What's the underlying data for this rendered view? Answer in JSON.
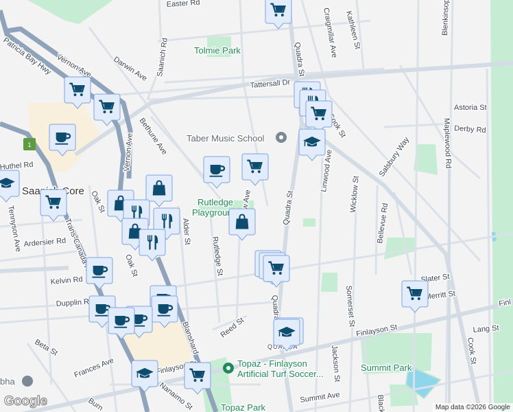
{
  "map": {
    "streets": {
      "easter": "Easter Rd",
      "saanich": "Saanich Rd",
      "darwin": "Darwin Ave",
      "vernon1": "Vernon Ave",
      "vernon2": "Vernon Ave",
      "patricia": "Patricia Bay Hwy",
      "tattersall": "Tattersall Dr",
      "bethune": "Bethune Ave",
      "quadra1": "Quadra St",
      "quadra2": "Quadra St",
      "quadra3": "Quadra St",
      "craigmillar": "Craigmillar Ave",
      "kathleen": "Kathleen St",
      "blenkinsop": "Blenkinsop",
      "astoria": "Astoria St",
      "derby": "Derby Rd",
      "maplewood": "Maplewood Rd",
      "salsbury": "Salsbury Way",
      "linwood": "Linwood Ave",
      "wicklow": "Wicklow St",
      "bellevue": "Bellevue Rd",
      "cook1": "Cook St",
      "cook2": "Cook St",
      "huthel": "Huthel Rd",
      "oak1": "Oak St",
      "oak2": "Oak St",
      "tennyson": "Tennyson Ave",
      "ardersier": "Ardersier Rd",
      "transcanada": "Trans-Canada Hwy",
      "kelvin": "Kelvin Rd",
      "dupplin": "Dupplin Rd",
      "glasgow": "Glasgow Ave",
      "alder": "Alder St",
      "rutledge": "Rutledge St",
      "reed": "Reed St",
      "blanshard": "Blanshard",
      "beta": "Beta St",
      "frances": "Frances Ave",
      "finlayson1": "Finlayson St",
      "finlayson2": "Finlayson St",
      "finlayson3": "Finl",
      "nanaimo": "Nanaimo St",
      "somerset": "Somerset St",
      "jackson": "Jackson St",
      "slater": "Slater St",
      "merritt": "Merritt St",
      "lang": "Lang St",
      "summit": "Summit Ave",
      "black": "Black",
      "burnside": "Burn",
      "quadra_village": "QUADRA"
    },
    "places": {
      "tolmie": "Tolmie Park",
      "taber": "Taber Music School",
      "rutledge1": "Rutledge",
      "rutledge2": "Playground",
      "saanich_core": "Saanich Core",
      "topaz1": "Topaz - Finlayson",
      "topaz2": "Artificial Turf Soccer...",
      "topaz_park": "Topaz Park",
      "summit_park": "Summit Park",
      "sabha": "bha"
    },
    "highway_shield": "1",
    "attribution": "Map data ©2026 Google",
    "logo": "Google",
    "marker_types": [
      "grocery-cart",
      "coffee-cup",
      "shopping-bag",
      "restaurant",
      "school"
    ]
  }
}
